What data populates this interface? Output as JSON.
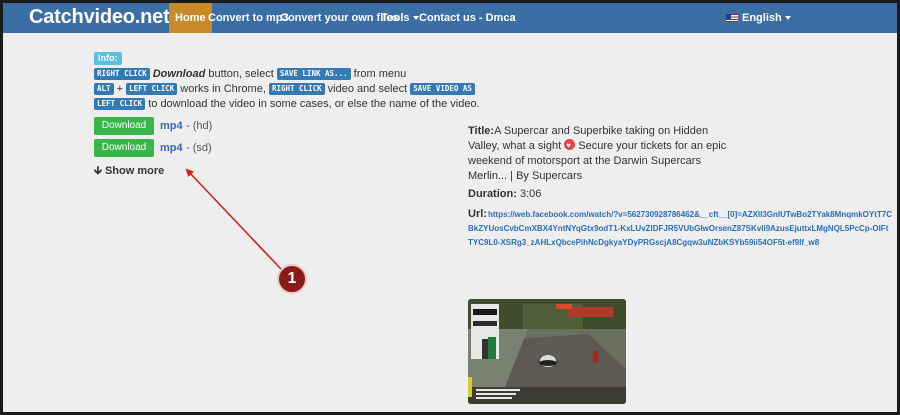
{
  "navbar": {
    "logo": "Catchvideo.net",
    "items": [
      {
        "label": "Home",
        "active": true
      },
      {
        "label": "Convert to mp3"
      },
      {
        "label": "Convert your own files"
      },
      {
        "label": "Tools"
      },
      {
        "label": "Contact us - Dmca"
      }
    ],
    "language": "English"
  },
  "info": {
    "badge": "Info:",
    "line1": {
      "kbd_right_click": "RIGHT CLICK",
      "download_word": "Download",
      "text_a": " button, select ",
      "kbd_save_link": "SAVE LINK AS...",
      "text_b": " from menu"
    },
    "line2": {
      "kbd_alt": "ALT",
      "plus": " + ",
      "kbd_left_click": "LEFT CLICK",
      "text_a": " works in Chrome, ",
      "kbd_right_click": "RIGHT CLICK",
      "text_b": " video and select ",
      "kbd_save_video": "SAVE VIDEO AS"
    },
    "line3": {
      "kbd_left_click": "LEFT CLICK",
      "text": " to download the video in some cases, or else the name of the video."
    }
  },
  "downloads": [
    {
      "button": "Download",
      "format": "mp4",
      "dash": "-",
      "quality": "(hd)"
    },
    {
      "button": "Download",
      "format": "mp4",
      "dash": "-",
      "quality": "(sd)"
    }
  ],
  "show_more": "Show more",
  "annotation": {
    "step": "1"
  },
  "video": {
    "title_label": "Title:",
    "title_text_a": "A Supercar and Superbike taking on Hidden Valley, what a sight ",
    "title_text_b": " Secure your tickets for an epic weekend of motorsport at the Darwin Supercars Merlin... | By Supercars",
    "duration_label": "Duration:",
    "duration": "3:06",
    "url_label": "Url:",
    "url": "https://web.facebook.com/watch/?v=562730928786462&__cft__[0]=AZXlI3GnIUTwBo2TYak8MnqmkOYtT7CBkZYUosCvbCmXBX4YntNYqGtx9odT1-KxLUvZIDFJR5VUbGIwOrsenZ87SKvIi9AzusEjuttxLMgNQL5PcCp-OIFtTYC9L0-XSRg3_zAHLxQbcePihNcDgkyaYDyPRGscjA8Cgqw3uNZbKSYb59ii54OF5t-ef9lf_w8"
  },
  "colors": {
    "navbar": "#3b6ea5",
    "home_active": "#c98a2a",
    "download_button": "#39b54a",
    "kbd": "#337ab7",
    "info_badge": "#5bc0de",
    "link": "#2a6eb8",
    "annotation": "#8b1a1a"
  },
  "icons": {
    "show_more": "arrow-down-icon",
    "emoji": "heart-eyes-emoji-icon",
    "flag": "us-flag-icon",
    "caret": "caret-down-icon"
  }
}
